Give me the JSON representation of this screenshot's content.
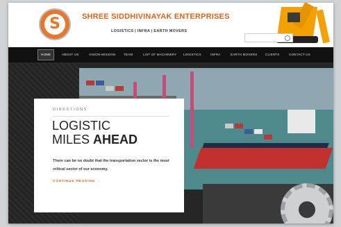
{
  "header": {
    "brand": "SHREE SIDDHIVINAYAK ENTERPRISES",
    "tagline": "LOGISTICS | INFRA | EARTH MOVERS",
    "logo_letter": "S",
    "search": {
      "placeholder": ""
    }
  },
  "nav": {
    "items": [
      {
        "label": "HOME",
        "active": true
      },
      {
        "label": "ABOUT US"
      },
      {
        "label": "VISION-MISSION"
      },
      {
        "label": "TEAM"
      },
      {
        "label": "LIST OF MACHINERY"
      },
      {
        "label": "LOGISTICS"
      },
      {
        "label": "INFRA"
      },
      {
        "label": "EARTH MOVERS"
      },
      {
        "label": "CLIENTS"
      },
      {
        "label": "CONTACT US"
      }
    ]
  },
  "hero": {
    "kicker": "DIRECTIONS",
    "title_line1": "LOGISTIC",
    "title_line2_plain": "MILES ",
    "title_line2_bold": "AHEAD",
    "body": "There can be no doubt that the transportation sector is the most critical sector of our economy.",
    "cta": "CONTINUE READING →"
  },
  "colors": {
    "brand_orange": "#e0641e",
    "nav_bg": "#111111",
    "hero_bg": "#262626"
  },
  "icons": [
    "logo-icon",
    "search-icon"
  ]
}
